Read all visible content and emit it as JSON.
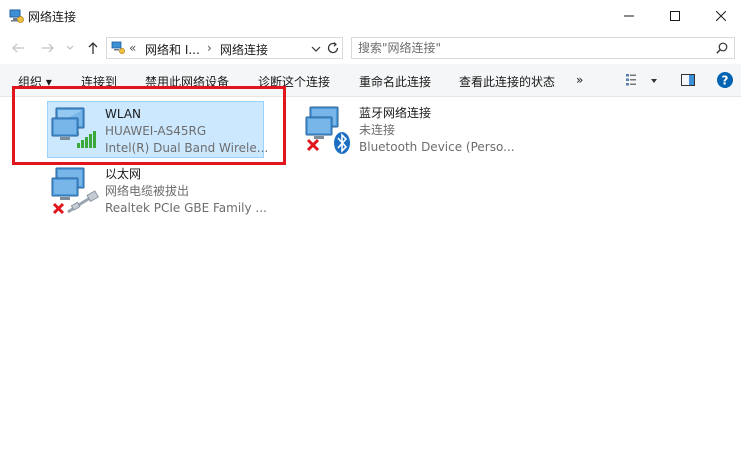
{
  "window": {
    "title": "网络连接",
    "minimize_icon": "minimize-icon",
    "maximize_icon": "maximize-icon",
    "close_icon": "close-icon"
  },
  "address": {
    "overflow": "«",
    "crumbs": [
      "网络和 I...",
      "网络连接"
    ],
    "separator": "›"
  },
  "search": {
    "placeholder": "搜索\"网络连接\""
  },
  "toolbar": {
    "organize": "组织 ▾",
    "connect_to": "连接到",
    "disable_device": "禁用此网络设备",
    "diagnose": "诊断这个连接",
    "rename": "重命名此连接",
    "view_status": "查看此连接的状态",
    "more": "»",
    "help": "?"
  },
  "connections": [
    {
      "name": "WLAN",
      "status": "HUAWEI-AS45RG",
      "device": "Intel(R) Dual Band Wirele...",
      "icon": "wifi-signal-icon",
      "selected": true
    },
    {
      "name": "蓝牙网络连接",
      "status": "未连接",
      "device": "Bluetooth Device (Perso...",
      "icon": "bluetooth-icon",
      "selected": false
    },
    {
      "name": "以太网",
      "status": "网络电缆被拔出",
      "device": "Realtek PCIe GBE Family ...",
      "icon": "ethernet-cable-icon",
      "selected": false
    }
  ],
  "colors": {
    "selection_fill": "#cce8ff",
    "selection_border": "#99d1ff",
    "annotation_red": "#e0161c",
    "help_blue": "#0063b1"
  }
}
